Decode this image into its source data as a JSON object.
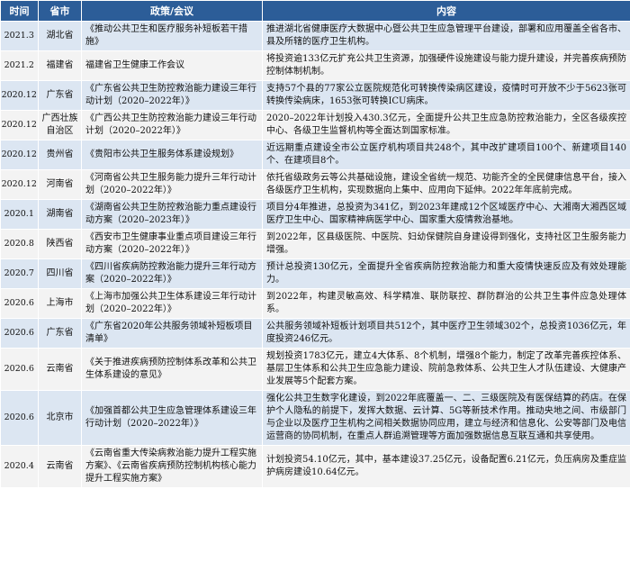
{
  "header": {
    "time": "时间",
    "province": "省市",
    "policy": "政策/会议",
    "content": "内容"
  },
  "rows": [
    {
      "time": "2021.3",
      "province": "湖北省",
      "policy": "《推动公共卫生和医疗服务补短板若干措施》",
      "content": "推进湖北省健康医疗大数据中心暨公共卫生应急管理平台建设，部署和应用覆盖全省各市、县及所辖的医疗卫生机构。"
    },
    {
      "time": "2021.2",
      "province": "福建省",
      "policy": "福建省卫生健康工作会议",
      "content": "将投资逾133亿元扩充公共卫生资源，加强硬件设施建设与能力提升建设，并完善疾病预防控制体制机制。"
    },
    {
      "time": "2020.12",
      "province": "广东省",
      "policy": "《广东省公共卫生防控救治能力建设三年行动计划（2020–2022年）》",
      "content": "支持57个县的77家公立医院规范化可转换传染病区建设，疫情时可开放不少于5623张可转换传染病床，1653张可转换ICU病床。"
    },
    {
      "time": "2020.12",
      "province": "广西壮族自治区",
      "policy": "《广西公共卫生防控救治能力建设三年行动计划（2020–2022年）》",
      "content": "2020–2022年计划投入430.3亿元，全面提升公共卫生应急防控救治能力，全区各级疾控中心、各级卫生监督机构等全面达到国家标准。"
    },
    {
      "time": "2020.12",
      "province": "贵州省",
      "policy": "《贵阳市公共卫生服务体系建设规划》",
      "content": "近远期重点建设全市公立医疗机构项目共248个，其中改扩建项目100个、新建项目140个、在建项目8个。"
    },
    {
      "time": "2020.12",
      "province": "河南省",
      "policy": "《河南省公共卫生服务能力提升三年行动计划（2020–2022年）》",
      "content": "依托省级政务云等公共基础设施，建设全省统一规范、功能齐全的全民健康信息平台，接入各级医疗卫生机构，实现数据向上集中、应用向下延伸。2022年年底前完成。"
    },
    {
      "time": "2020.1",
      "province": "湖南省",
      "policy": "《湖南省公共卫生防控救治能力重点建设行动方案（2020–2023年）》",
      "content": "项目分4年推进，总投资为341亿，到2023年建成12个区域医疗中心、大湘南大湘西区域医疗卫生中心、国家精神病医学中心、国家重大疫情救治基地。"
    },
    {
      "time": "2020.8",
      "province": "陕西省",
      "policy": "《西安市卫生健康事业重点项目建设三年行动方案（2020–2022年）》",
      "content": "到2022年，区县级医院、中医院、妇幼保健院自身建设得到强化，支持社区卫生服务能力增强。"
    },
    {
      "time": "2020.7",
      "province": "四川省",
      "policy": "《四川省疾病防控救治能力提升三年行动方案（2020–2022年）》",
      "content": "预计总投资130亿元，全面提升全省疾病防控救治能力和重大疫情快速反应及有效处理能力。"
    },
    {
      "time": "2020.6",
      "province": "上海市",
      "policy": "《上海市加强公共卫生体系建设三年行动计划（2020–2022年）》",
      "content": "到2022年，构建灵敏高效、科学精准、联防联控、群防群治的公共卫生事件应急处理体系。"
    },
    {
      "time": "2020.6",
      "province": "广东省",
      "policy": "《广东省2020年公共服务领域补短板项目清单》",
      "content": "公共服务领域补短板计划项目共512个，其中医疗卫生领域302个，总投资1036亿元，年度投资246亿元。"
    },
    {
      "time": "2020.6",
      "province": "云南省",
      "policy": "《关于推进疾病预防控制体系改革和公共卫生体系建设的意见》",
      "content": "规划投资1783亿元，建立4大体系、8个机制，增强8个能力，制定了改革完善疾控体系、基层卫生体系和公共卫生应急能力建设、院前急救体系、公共卫生人才队伍建设、大健康产业发展等5个配套方案。"
    },
    {
      "time": "2020.6",
      "province": "北京市",
      "policy": "《加强首都公共卫生应急管理体系建设三年行动计划（2020–2022年）》",
      "content": "强化公共卫生数字化建设，到2022年底覆盖一、二、三级医院及有医保结算的药店。在保护个人隐私的前提下，发挥大数据、云计算、5G等新技术作用。推动央地之间、市级部门与企业以及医疗卫生机构之间相关数据协同应用，建立与经济和信息化、公安等部门及电信运营商的协同机制，在重点人群追溯管理等方面加强数据信息互联互通和共享使用。"
    },
    {
      "time": "2020.4",
      "province": "云南省",
      "policy": "《云南省重大传染病救治能力提升工程实施方案》、《云南省疾病预防控制机构核心能力提升工程实施方案》",
      "content": "计划投资54.10亿元，其中，基本建设37.25亿元，设备配置6.21亿元，负压病房及重症监护病房建设10.64亿元。"
    }
  ]
}
